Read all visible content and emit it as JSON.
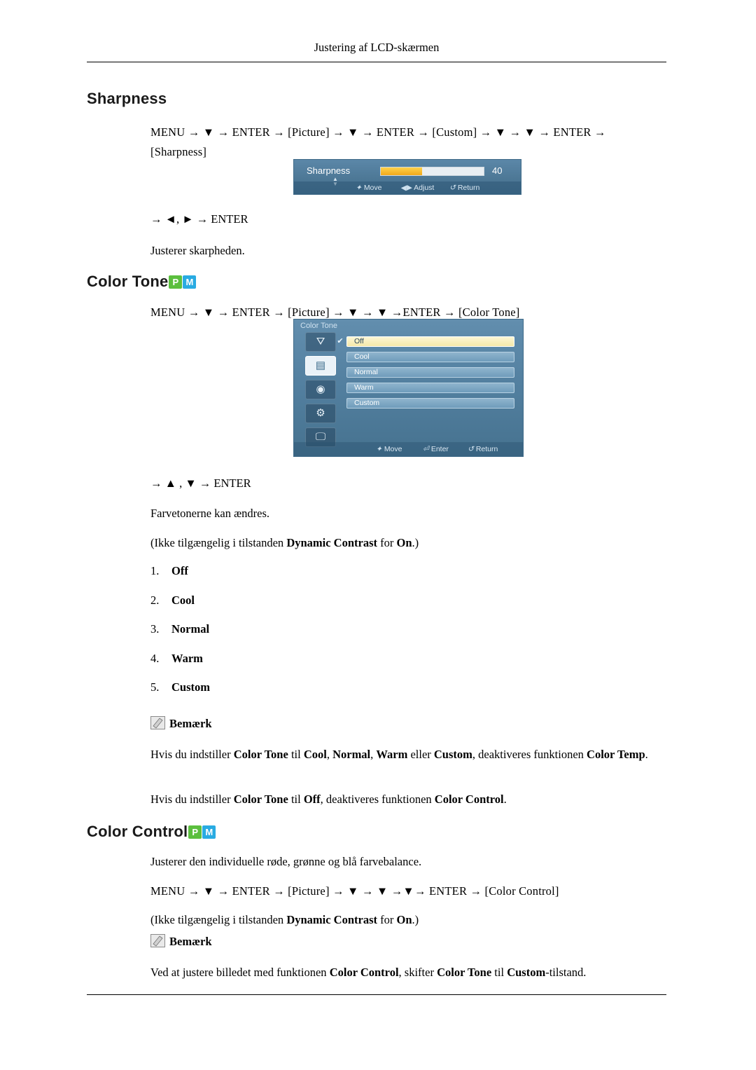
{
  "header": {
    "running_head": "Justering af LCD-skærmen"
  },
  "sections": {
    "sharpness": {
      "heading": "Sharpness",
      "menu_path_line1": "MENU → ▼ → ENTER → [Picture] → ▼ → ENTER → [Custom] → ▼ → ▼ → ENTER →",
      "menu_path_line2": "[Sharpness]",
      "key_line": "→ ◄, ► → ENTER",
      "description": "Justerer skarpheden.",
      "osd": {
        "label": "Sharpness",
        "value": "40",
        "slider_percent": 40,
        "foot_move": "Move",
        "foot_adjust": "Adjust",
        "foot_return": "Return"
      }
    },
    "color_tone": {
      "heading": "Color Tone",
      "badges": [
        "P",
        "M"
      ],
      "menu_path": "MENU → ▼ → ENTER → [Picture] → ▼ → ▼ →ENTER → [Color Tone]",
      "key_line": "→ ▲ , ▼ → ENTER",
      "description": "Farvetonerne kan ændres.",
      "availability_note_pre": "(Ikke tilgængelig i tilstanden ",
      "availability_note_bold": "Dynamic Contrast",
      "availability_note_mid": " for ",
      "availability_note_bold2": "On",
      "availability_note_post": ".)",
      "osd": {
        "title": "Color Tone",
        "options": [
          "Off",
          "Cool",
          "Normal",
          "Warm",
          "Custom"
        ],
        "selected_index": 0,
        "foot_move": "Move",
        "foot_enter": "Enter",
        "foot_return": "Return",
        "sidebar_icons": [
          "input-icon",
          "picture-icon",
          "sound-icon",
          "setup-icon",
          "multi-control-icon"
        ],
        "sidebar_selected_index": 1
      },
      "numbered_list": [
        {
          "num": "1.",
          "value": "Off"
        },
        {
          "num": "2.",
          "value": "Cool"
        },
        {
          "num": "3.",
          "value": "Normal"
        },
        {
          "num": "4.",
          "value": "Warm"
        },
        {
          "num": "5.",
          "value": "Custom"
        }
      ],
      "note_label": "Bemærk",
      "note_body_1": "Hvis du indstiller Color Tone til Cool, Normal, Warm eller Custom, deaktiveres funktionen Color Temp.",
      "note_body_2": "Hvis du indstiller Color Tone til Off, deaktiveres funktionen Color Control."
    },
    "color_control": {
      "heading": "Color Control",
      "badges": [
        "P",
        "M"
      ],
      "description": "Justerer den individuelle røde, grønne og blå farvebalance.",
      "menu_path": "MENU → ▼ → ENTER → [Picture] → ▼ → ▼ →▼→ ENTER → [Color Control]",
      "availability_note": "(Ikke tilgængelig i tilstanden Dynamic Contrast for On.)",
      "note_label": "Bemærk",
      "note_body": "Ved at justere billedet med funktionen Color Control, skifter Color Tone til Custom-tilstand."
    }
  }
}
